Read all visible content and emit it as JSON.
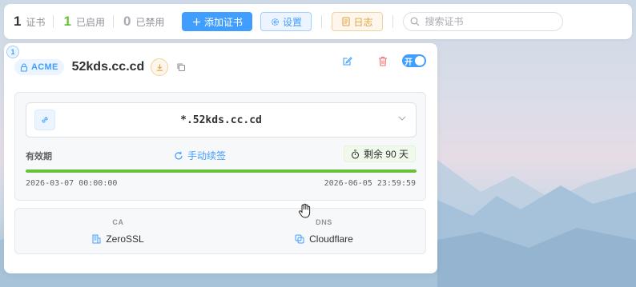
{
  "toolbar": {
    "stats": {
      "total_count": "1",
      "total_label": "证书",
      "enabled_count": "1",
      "enabled_label": "已启用",
      "disabled_count": "0",
      "disabled_label": "已禁用"
    },
    "add_label": "添加证书",
    "settings_label": "设置",
    "log_label": "日志",
    "search_placeholder": "搜索证书"
  },
  "certificate": {
    "index": "1",
    "type_tag": "ACME",
    "title": "52kds.cc.cd",
    "switch_label": "开",
    "enabled": true,
    "domain": "*.52kds.cc.cd",
    "validity_label": "有效期",
    "renew_label": "手动续签",
    "remaining_label": "剩余 90 天",
    "valid_from": "2026-03-07 00:00:00",
    "valid_to": "2026-06-05 23:59:59",
    "validity_progress": 1.0,
    "ca_label": "CA",
    "ca_value": "ZeroSSL",
    "dns_label": "DNS",
    "dns_value": "Cloudflare"
  },
  "colors": {
    "primary": "#409eff",
    "success": "#67c23a",
    "warning": "#e6a23c",
    "danger": "#f56c6c"
  },
  "icons": {
    "add": "plus-icon",
    "settings": "gear-icon",
    "log": "document-icon",
    "search": "search-icon",
    "lock": "lock-icon",
    "download": "download-icon",
    "copy": "copy-icon",
    "edit": "edit-icon",
    "delete": "trash-icon",
    "link": "link-icon",
    "arrow": "chevron-down-icon",
    "renew": "refresh-icon",
    "timer": "stopwatch-icon",
    "ca": "building-icon",
    "dns": "copy-icon",
    "cursor": "hand-cursor-icon"
  }
}
